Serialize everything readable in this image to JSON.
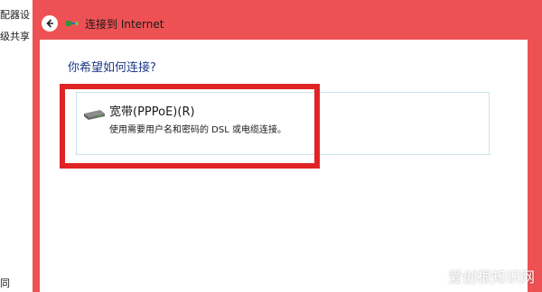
{
  "background_window": {
    "line1": "配器设",
    "line2": "级共享",
    "line3": "",
    "line4": "同"
  },
  "dialog": {
    "title": "连接到 Internet",
    "question": "你希望如何连接?",
    "option": {
      "title": "宽带(PPPoE)(R)",
      "description": "使用需要用户名和密码的 DSL 或电缆连接。"
    }
  },
  "watermark": "爱创根知识网",
  "colors": {
    "frame": "#ee5153",
    "highlight": "#e02426",
    "question": "#1e3a8a"
  },
  "icons": [
    "back-arrow-icon",
    "network-icon",
    "broadband-drive-icon"
  ]
}
